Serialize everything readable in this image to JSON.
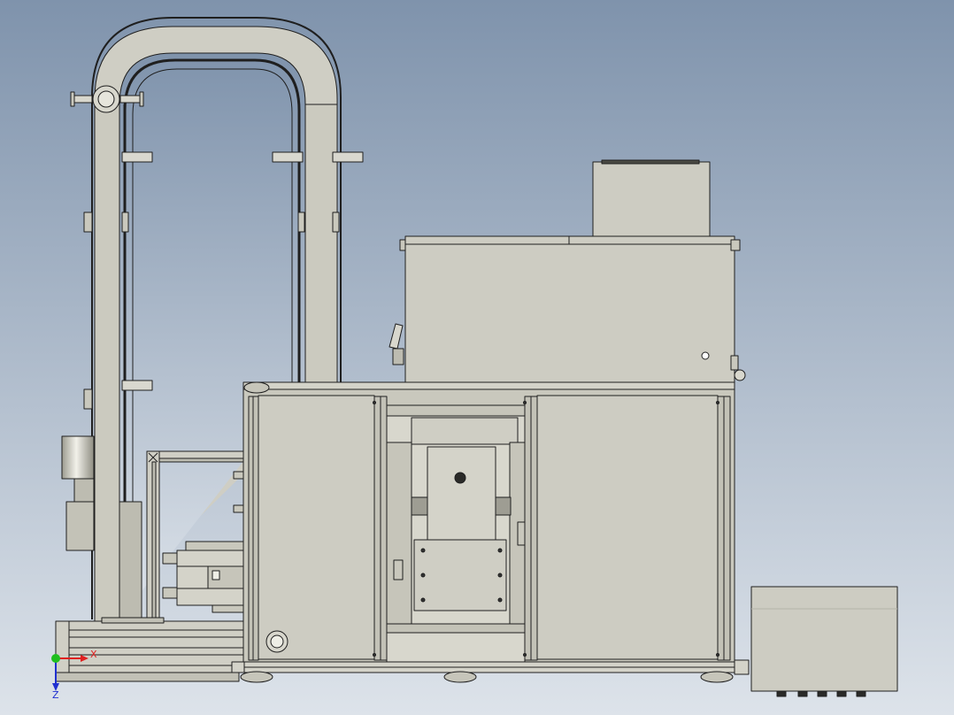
{
  "colors": {
    "background_top": "#7f93ac",
    "background_bottom": "#dde3ea",
    "part_fill": "#c9c8bd",
    "part_fill_light": "#d4d3c9",
    "part_fill_dark": "#b8b7ab",
    "edge": "#1f1f1f",
    "triad_x": "#e02020",
    "triad_y": "#1fbf1f",
    "triad_z": "#2030d0"
  },
  "triad": {
    "x_label": "X",
    "z_label": "Z"
  }
}
